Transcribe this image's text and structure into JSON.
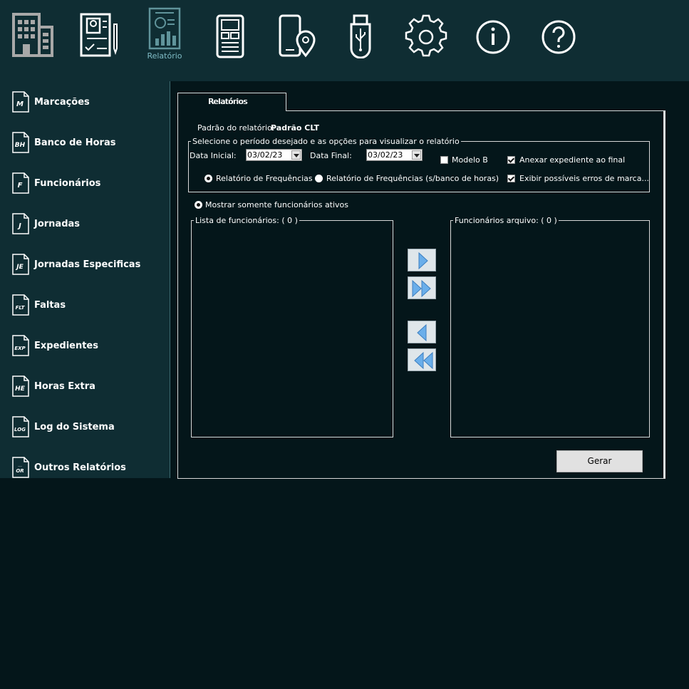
{
  "toolbar": {
    "items": [
      {
        "name": "empresa",
        "label": ""
      },
      {
        "name": "cadastros",
        "label": ""
      },
      {
        "name": "relatorio",
        "label": "Relatório"
      },
      {
        "name": "relogio",
        "label": ""
      },
      {
        "name": "localizacao",
        "label": ""
      },
      {
        "name": "pendrive",
        "label": ""
      },
      {
        "name": "configuracoes",
        "label": ""
      },
      {
        "name": "informacoes",
        "label": ""
      },
      {
        "name": "ajuda",
        "label": ""
      }
    ]
  },
  "sidebar": {
    "items": [
      {
        "abbr": "M",
        "label": "Marcações"
      },
      {
        "abbr": "BH",
        "label": "Banco de Horas"
      },
      {
        "abbr": "F",
        "label": "Funcionários"
      },
      {
        "abbr": "J",
        "label": "Jornadas"
      },
      {
        "abbr": "JE",
        "label": "Jornadas Especificas"
      },
      {
        "abbr": "FLT",
        "label": "Faltas"
      },
      {
        "abbr": "EXP",
        "label": "Expedientes"
      },
      {
        "abbr": "HE",
        "label": "Horas Extra"
      },
      {
        "abbr": "LOG",
        "label": "Log do Sistema"
      },
      {
        "abbr": "OR",
        "label": "Outros Relatórios"
      }
    ]
  },
  "tab": {
    "label": "Relatórios"
  },
  "report": {
    "pattern_label": "Padrão do relatório:",
    "pattern_value": "Padrão CLT",
    "period_legend": "Selecione o período desejado e as opções para visualizar o relatório",
    "start_label": "Data Inicial:",
    "start_value": "03/02/23",
    "end_label": "Data Final:",
    "end_value": "03/02/23",
    "modelo_b": "Modelo B",
    "anexar": "Anexar expediente ao final",
    "freq": "Relatório de Frequências",
    "freq_sem_bh": "Relatório de Frequências (s/banco de horas)",
    "erros": "Exibir possíveis erros de marca...",
    "ativos": "Mostrar somente funcionários ativos",
    "list_left": "Lista de funcionários: ( 0 )",
    "list_right": "Funcionários arquivo: ( 0 )",
    "generate": "Gerar"
  }
}
